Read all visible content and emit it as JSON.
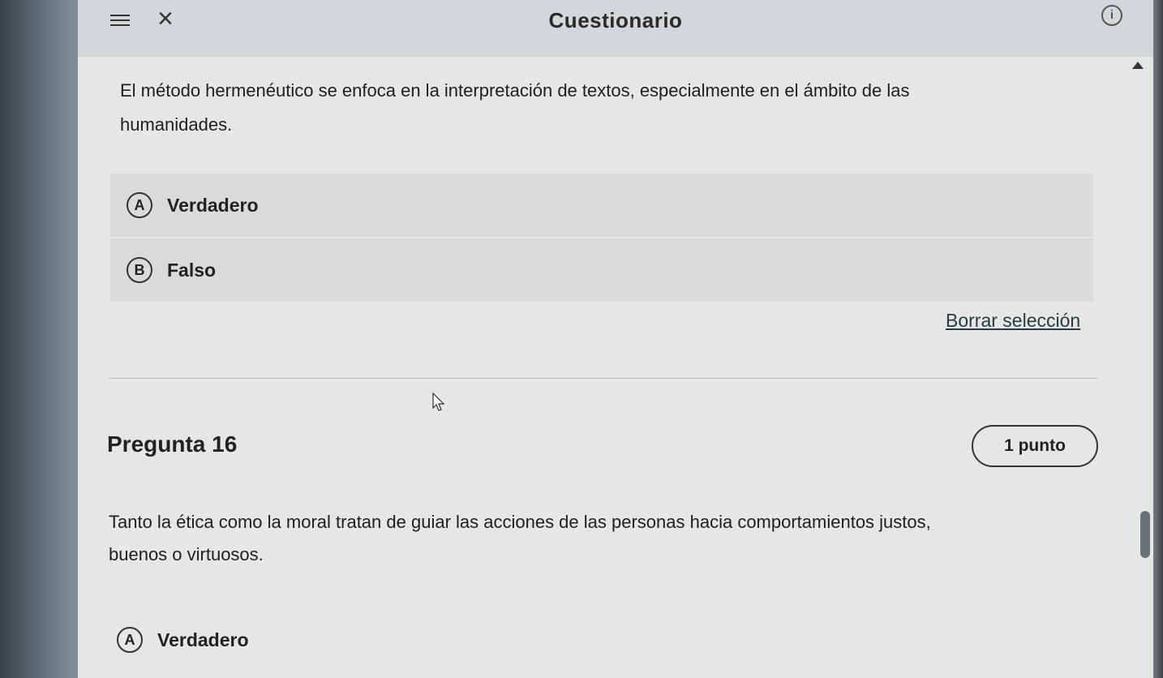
{
  "header": {
    "title": "Cuestionario",
    "menu_icon": "hamburger-menu-icon",
    "close_icon": "close-icon",
    "info_icon": "info-icon",
    "info_glyph": "i"
  },
  "question_prev": {
    "text_line1": "El método hermenéutico se enfoca en la interpretación de textos, especialmente en el ámbito de las",
    "text_line2": "humanidades.",
    "options": [
      {
        "letter": "A",
        "label": "Verdadero"
      },
      {
        "letter": "B",
        "label": "Falso"
      }
    ],
    "clear_label": "Borrar selección"
  },
  "question_16": {
    "title": "Pregunta 16",
    "points": "1 punto",
    "text_line1": "Tanto la  ética como la moral tratan de guiar las acciones de las personas hacia comportamientos justos,",
    "text_line2": "buenos o virtuosos.",
    "options": [
      {
        "letter": "A",
        "label": "Verdadero"
      }
    ]
  }
}
